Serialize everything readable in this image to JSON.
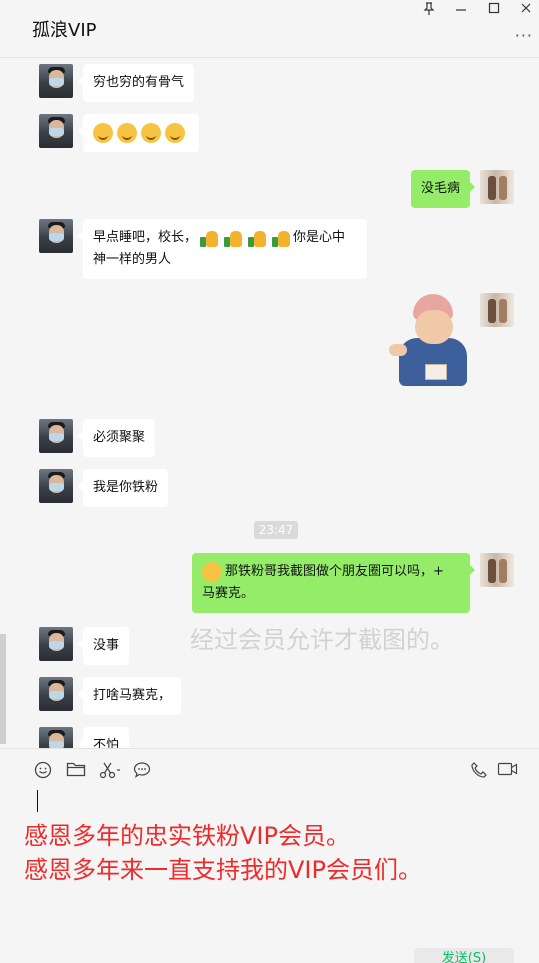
{
  "window": {
    "title": "孤浪VIP",
    "pin_icon": "pin-icon",
    "minimize_icon": "minimize-icon",
    "maximize_icon": "maximize-icon",
    "close_icon": "close-icon",
    "more_icon": "more-icon"
  },
  "messages": [
    {
      "sender": "them",
      "text": "穷也穷的有骨气"
    },
    {
      "sender": "them",
      "type": "emoji",
      "emoji": "smirk-face",
      "count": 4
    },
    {
      "sender": "me",
      "text": "没毛病"
    },
    {
      "sender": "them",
      "text_before": "早点睡吧，校长，",
      "emoji": "thumbs-up",
      "count": 4,
      "text_after": "你是心中",
      "text_line2": "神一样的男人"
    },
    {
      "sender": "me",
      "type": "sticker",
      "sticker": "baby-sticker"
    },
    {
      "sender": "them",
      "text": "必须聚聚"
    },
    {
      "sender": "them",
      "text": "我是你铁粉"
    },
    {
      "type": "timestamp",
      "text": "23:47"
    },
    {
      "sender": "me",
      "emoji": "wink-face",
      "text_line1": "那铁粉哥我截图做个朋友圈可以吗，+",
      "text_line2": "马赛克。"
    },
    {
      "sender": "them",
      "text": "没事"
    },
    {
      "sender": "them",
      "text": "打啥马赛克，"
    },
    {
      "sender": "them",
      "text": "不怕"
    }
  ],
  "watermark": "经过会员允许才截图的。",
  "composer": {
    "tools": [
      "emoji-icon",
      "folder-icon",
      "scissors-icon",
      "chat-history-icon"
    ],
    "right_tools": [
      "phone-icon",
      "video-icon"
    ],
    "input_line1": "感恩多年的忠实铁粉VIP会员。",
    "input_line2": "感恩多年来一直支持我的VIP会员们。",
    "send_label": "发送(S)"
  },
  "colors": {
    "my_bubble": "#95ec69",
    "their_bubble": "#ffffff",
    "background": "#f5f5f5",
    "input_text": "#ee2b2b",
    "send_text": "#07c160"
  }
}
